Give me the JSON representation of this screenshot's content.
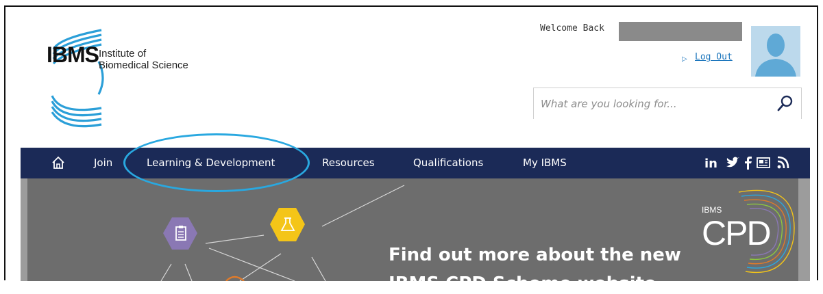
{
  "logo": {
    "abbrev": "IBMS",
    "name_line1": "Institute of",
    "name_line2": "Biomedical Science"
  },
  "header": {
    "welcome_text": "Welcome Back",
    "logout_label": "Log Out"
  },
  "search": {
    "placeholder": "What are you looking for..."
  },
  "nav": {
    "items": [
      {
        "label": "Join"
      },
      {
        "label": "Learning & Development"
      },
      {
        "label": "Resources"
      },
      {
        "label": "Qualifications"
      },
      {
        "label": "My IBMS"
      }
    ],
    "social_icons": [
      "linkedin-icon",
      "twitter-icon",
      "facebook-icon",
      "newsletter-icon",
      "rss-icon"
    ]
  },
  "banner": {
    "heading_line1": "Find out more about the new",
    "heading_line2": "IBMS CPD Scheme website",
    "badge_small": "IBMS",
    "badge_big": "CPD"
  },
  "colors": {
    "nav_bg": "#1b2a57",
    "accent": "#29a8e0",
    "link": "#1b75bc",
    "banner_bg": "#6d6d6d",
    "hex_purple": "#8a78b4",
    "hex_yellow": "#f4c518"
  }
}
